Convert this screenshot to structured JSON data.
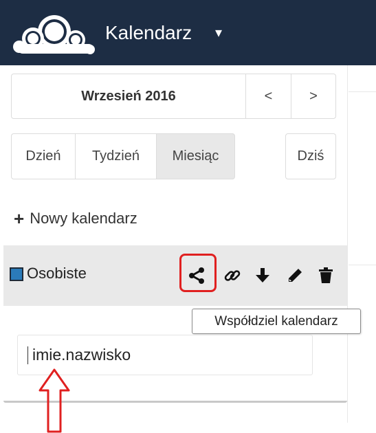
{
  "header": {
    "app_title": "Kalendarz",
    "caret": "▾",
    "logo_icon": "owncloud-logo"
  },
  "navigation": {
    "month_label": "Wrzesień 2016",
    "prev_label": "<",
    "next_label": ">"
  },
  "views": {
    "day": "Dzień",
    "week": "Tydzień",
    "month": "Miesiąc",
    "today": "Dziś",
    "active": "Miesiąc"
  },
  "new_calendar": {
    "plus": "+",
    "label": "Nowy kalendarz"
  },
  "calendar": {
    "name": "Osobiste",
    "color": "#2b7bb9",
    "actions": [
      "share-icon",
      "link-icon",
      "download-icon",
      "edit-icon",
      "delete-icon"
    ]
  },
  "tooltip": {
    "text": "Współdziel kalendarz"
  },
  "share_input": {
    "value": "imie.nazwisko"
  },
  "annotation": {
    "highlight_color": "#e02020"
  }
}
